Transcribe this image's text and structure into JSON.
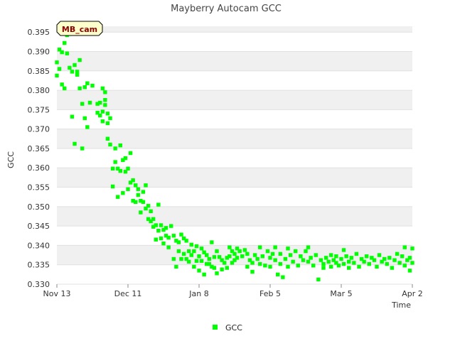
{
  "chart_data": {
    "type": "scatter",
    "title": "Mayberry Autocam GCC",
    "xlabel": "Time",
    "ylabel": "GCC",
    "site_label": "MB_cam",
    "x_ticks": [
      "Nov 13",
      "Dec 11",
      "Jan 8",
      "Feb 5",
      "Mar 5",
      "Apr 2"
    ],
    "xlim": [
      "Nov 13",
      "Apr 2"
    ],
    "y_ticks": [
      0.33,
      0.335,
      0.34,
      0.345,
      0.35,
      0.355,
      0.36,
      0.365,
      0.37,
      0.375,
      0.38,
      0.385,
      0.39,
      0.395
    ],
    "ylim": [
      0.33,
      0.3965
    ],
    "grid": "alternating horizontal bands",
    "legend_position": "bottom-center",
    "series": [
      {
        "name": "GCC",
        "color": "#00ff00",
        "marker": "square",
        "points": [
          {
            "x": "Nov 13",
            "y": 0.3872
          },
          {
            "x": "Nov 13",
            "y": 0.3838
          },
          {
            "x": "Nov 14",
            "y": 0.3855
          },
          {
            "x": "Nov 14",
            "y": 0.3905
          },
          {
            "x": "Nov 15",
            "y": 0.3898
          },
          {
            "x": "Nov 15",
            "y": 0.3815
          },
          {
            "x": "Nov 16",
            "y": 0.3922
          },
          {
            "x": "Nov 16",
            "y": 0.3805
          },
          {
            "x": "Nov 17",
            "y": 0.3942
          },
          {
            "x": "Nov 17",
            "y": 0.3895
          },
          {
            "x": "Nov 18",
            "y": 0.3948
          },
          {
            "x": "Nov 18",
            "y": 0.3858
          },
          {
            "x": "Nov 19",
            "y": 0.3848
          },
          {
            "x": "Nov 19",
            "y": 0.3732
          },
          {
            "x": "Nov 20",
            "y": 0.3865
          },
          {
            "x": "Nov 20",
            "y": 0.3662
          },
          {
            "x": "Nov 21",
            "y": 0.384
          },
          {
            "x": "Nov 21",
            "y": 0.3848
          },
          {
            "x": "Nov 22",
            "y": 0.3805
          },
          {
            "x": "Nov 22",
            "y": 0.3878
          },
          {
            "x": "Nov 23",
            "y": 0.3765
          },
          {
            "x": "Nov 23",
            "y": 0.365
          },
          {
            "x": "Nov 24",
            "y": 0.3808
          },
          {
            "x": "Nov 24",
            "y": 0.3728
          },
          {
            "x": "Nov 25",
            "y": 0.3818
          },
          {
            "x": "Nov 25",
            "y": 0.3705
          },
          {
            "x": "Nov 26",
            "y": 0.3768
          },
          {
            "x": "Nov 27",
            "y": 0.3812
          },
          {
            "x": "Nov 29",
            "y": 0.3742
          },
          {
            "x": "Nov 29",
            "y": 0.3765
          },
          {
            "x": "Nov 30",
            "y": 0.3735
          },
          {
            "x": "Nov 30",
            "y": 0.3768
          },
          {
            "x": "Dec 1",
            "y": 0.3745
          },
          {
            "x": "Dec 1",
            "y": 0.372
          },
          {
            "x": "Dec 1",
            "y": 0.3805
          },
          {
            "x": "Dec 2",
            "y": 0.3775
          },
          {
            "x": "Dec 2",
            "y": 0.3795
          },
          {
            "x": "Dec 2",
            "y": 0.3762
          },
          {
            "x": "Dec 3",
            "y": 0.374
          },
          {
            "x": "Dec 3",
            "y": 0.3715
          },
          {
            "x": "Dec 3",
            "y": 0.3675
          },
          {
            "x": "Dec 4",
            "y": 0.3728
          },
          {
            "x": "Dec 4",
            "y": 0.366
          },
          {
            "x": "Dec 5",
            "y": 0.3598
          },
          {
            "x": "Dec 5",
            "y": 0.3552
          },
          {
            "x": "Dec 6",
            "y": 0.365
          },
          {
            "x": "Dec 6",
            "y": 0.3615
          },
          {
            "x": "Dec 7",
            "y": 0.3598
          },
          {
            "x": "Dec 7",
            "y": 0.3525
          },
          {
            "x": "Dec 8",
            "y": 0.3658
          },
          {
            "x": "Dec 8",
            "y": 0.3592
          },
          {
            "x": "Dec 9",
            "y": 0.362
          },
          {
            "x": "Dec 9",
            "y": 0.3535
          },
          {
            "x": "Dec 10",
            "y": 0.3625
          },
          {
            "x": "Dec 10",
            "y": 0.359
          },
          {
            "x": "Dec 11",
            "y": 0.3598
          },
          {
            "x": "Dec 11",
            "y": 0.3545
          },
          {
            "x": "Dec 12",
            "y": 0.3638
          },
          {
            "x": "Dec 12",
            "y": 0.3562
          },
          {
            "x": "Dec 13",
            "y": 0.3515
          },
          {
            "x": "Dec 13",
            "y": 0.3568
          },
          {
            "x": "Dec 14",
            "y": 0.3555
          },
          {
            "x": "Dec 14",
            "y": 0.3512
          },
          {
            "x": "Dec 15",
            "y": 0.3545
          },
          {
            "x": "Dec 15",
            "y": 0.353
          },
          {
            "x": "Dec 16",
            "y": 0.3515
          },
          {
            "x": "Dec 16",
            "y": 0.3485
          },
          {
            "x": "Dec 17",
            "y": 0.3512
          },
          {
            "x": "Dec 17",
            "y": 0.3538
          },
          {
            "x": "Dec 18",
            "y": 0.3495
          },
          {
            "x": "Dec 18",
            "y": 0.3555
          },
          {
            "x": "Dec 19",
            "y": 0.3502
          },
          {
            "x": "Dec 19",
            "y": 0.3468
          },
          {
            "x": "Dec 20",
            "y": 0.3488
          },
          {
            "x": "Dec 20",
            "y": 0.3462
          },
          {
            "x": "Dec 21",
            "y": 0.3448
          },
          {
            "x": "Dec 21",
            "y": 0.3468
          },
          {
            "x": "Dec 22",
            "y": 0.3452
          },
          {
            "x": "Dec 22",
            "y": 0.3415
          },
          {
            "x": "Dec 23",
            "y": 0.3505
          },
          {
            "x": "Dec 23",
            "y": 0.3438
          },
          {
            "x": "Dec 24",
            "y": 0.3418
          },
          {
            "x": "Dec 24",
            "y": 0.3452
          },
          {
            "x": "Dec 25",
            "y": 0.3405
          },
          {
            "x": "Dec 25",
            "y": 0.344
          },
          {
            "x": "Dec 26",
            "y": 0.3425
          },
          {
            "x": "Dec 26",
            "y": 0.3445
          },
          {
            "x": "Dec 27",
            "y": 0.3395
          },
          {
            "x": "Dec 27",
            "y": 0.342
          },
          {
            "x": "Dec 28",
            "y": 0.345
          },
          {
            "x": "Dec 29",
            "y": 0.3425
          },
          {
            "x": "Dec 29",
            "y": 0.3365
          },
          {
            "x": "Dec 30",
            "y": 0.3412
          },
          {
            "x": "Dec 30",
            "y": 0.3345
          },
          {
            "x": "Dec 31",
            "y": 0.3408
          },
          {
            "x": "Dec 31",
            "y": 0.3385
          },
          {
            "x": "Jan 1",
            "y": 0.3428
          },
          {
            "x": "Jan 1",
            "y": 0.3365
          },
          {
            "x": "Jan 2",
            "y": 0.3418
          },
          {
            "x": "Jan 2",
            "y": 0.3378
          },
          {
            "x": "Jan 3",
            "y": 0.3412
          },
          {
            "x": "Jan 3",
            "y": 0.3365
          },
          {
            "x": "Jan 4",
            "y": 0.3385
          },
          {
            "x": "Jan 4",
            "y": 0.3358
          },
          {
            "x": "Jan 5",
            "y": 0.3402
          },
          {
            "x": "Jan 5",
            "y": 0.3375
          },
          {
            "x": "Jan 6",
            "y": 0.3385
          },
          {
            "x": "Jan 6",
            "y": 0.3345
          },
          {
            "x": "Jan 7",
            "y": 0.3398
          },
          {
            "x": "Jan 7",
            "y": 0.336
          },
          {
            "x": "Jan 8",
            "y": 0.3372
          },
          {
            "x": "Jan 8",
            "y": 0.3335
          },
          {
            "x": "Jan 9",
            "y": 0.3392
          },
          {
            "x": "Jan 9",
            "y": 0.336
          },
          {
            "x": "Jan 10",
            "y": 0.3382
          },
          {
            "x": "Jan 10",
            "y": 0.3325
          },
          {
            "x": "Jan 11",
            "y": 0.3375
          },
          {
            "x": "Jan 11",
            "y": 0.3352
          },
          {
            "x": "Jan 12",
            "y": 0.3365
          },
          {
            "x": "Jan 12",
            "y": 0.3352
          },
          {
            "x": "Jan 13",
            "y": 0.3408
          },
          {
            "x": "Jan 13",
            "y": 0.3345
          },
          {
            "x": "Jan 14",
            "y": 0.337
          },
          {
            "x": "Jan 14",
            "y": 0.3342
          },
          {
            "x": "Jan 15",
            "y": 0.3385
          },
          {
            "x": "Jan 15",
            "y": 0.3328
          },
          {
            "x": "Jan 16",
            "y": 0.337
          },
          {
            "x": "Jan 17",
            "y": 0.3362
          },
          {
            "x": "Jan 17",
            "y": 0.3338
          },
          {
            "x": "Jan 18",
            "y": 0.3355
          },
          {
            "x": "Jan 19",
            "y": 0.3368
          },
          {
            "x": "Jan 19",
            "y": 0.3342
          },
          {
            "x": "Jan 20",
            "y": 0.3395
          },
          {
            "x": "Jan 20",
            "y": 0.3372
          },
          {
            "x": "Jan 21",
            "y": 0.3385
          },
          {
            "x": "Jan 21",
            "y": 0.3355
          },
          {
            "x": "Jan 22",
            "y": 0.3378
          },
          {
            "x": "Jan 22",
            "y": 0.3362
          },
          {
            "x": "Jan 23",
            "y": 0.3392
          },
          {
            "x": "Jan 23",
            "y": 0.3368
          },
          {
            "x": "Jan 24",
            "y": 0.3385
          },
          {
            "x": "Jan 25",
            "y": 0.3372
          },
          {
            "x": "Jan 26",
            "y": 0.3388
          },
          {
            "x": "Jan 27",
            "y": 0.3345
          },
          {
            "x": "Jan 27",
            "y": 0.3378
          },
          {
            "x": "Jan 28",
            "y": 0.3362
          },
          {
            "x": "Jan 29",
            "y": 0.3355
          },
          {
            "x": "Jan 29",
            "y": 0.3332
          },
          {
            "x": "Jan 30",
            "y": 0.3375
          },
          {
            "x": "Jan 31",
            "y": 0.3365
          },
          {
            "x": "Feb 1",
            "y": 0.3395
          },
          {
            "x": "Feb 1",
            "y": 0.3352
          },
          {
            "x": "Feb 2",
            "y": 0.3372
          },
          {
            "x": "Feb 3",
            "y": 0.3348
          },
          {
            "x": "Feb 4",
            "y": 0.3385
          },
          {
            "x": "Feb 5",
            "y": 0.3368
          },
          {
            "x": "Feb 5",
            "y": 0.3345
          },
          {
            "x": "Feb 6",
            "y": 0.3378
          },
          {
            "x": "Feb 7",
            "y": 0.3395
          },
          {
            "x": "Feb 7",
            "y": 0.3362
          },
          {
            "x": "Feb 8",
            "y": 0.3325
          },
          {
            "x": "Feb 9",
            "y": 0.3352
          },
          {
            "x": "Feb 9",
            "y": 0.3378
          },
          {
            "x": "Feb 10",
            "y": 0.3318
          },
          {
            "x": "Feb 11",
            "y": 0.3365
          },
          {
            "x": "Feb 12",
            "y": 0.3392
          },
          {
            "x": "Feb 12",
            "y": 0.3345
          },
          {
            "x": "Feb 13",
            "y": 0.3375
          },
          {
            "x": "Feb 14",
            "y": 0.3358
          },
          {
            "x": "Feb 15",
            "y": 0.3385
          },
          {
            "x": "Feb 16",
            "y": 0.3348
          },
          {
            "x": "Feb 17",
            "y": 0.3372
          },
          {
            "x": "Feb 18",
            "y": 0.3362
          },
          {
            "x": "Feb 19",
            "y": 0.3385
          },
          {
            "x": "Feb 20",
            "y": 0.3395
          },
          {
            "x": "Feb 20",
            "y": 0.3358
          },
          {
            "x": "Feb 21",
            "y": 0.3368
          },
          {
            "x": "Feb 22",
            "y": 0.3348
          },
          {
            "x": "Feb 23",
            "y": 0.3375
          },
          {
            "x": "Feb 24",
            "y": 0.3312
          },
          {
            "x": "Feb 25",
            "y": 0.3362
          },
          {
            "x": "Feb 26",
            "y": 0.3352
          },
          {
            "x": "Feb 26",
            "y": 0.3342
          },
          {
            "x": "Feb 27",
            "y": 0.3368
          },
          {
            "x": "Feb 28",
            "y": 0.3358
          },
          {
            "x": "Mar 1",
            "y": 0.3375
          },
          {
            "x": "Mar 1",
            "y": 0.3345
          },
          {
            "x": "Mar 2",
            "y": 0.3362
          },
          {
            "x": "Mar 3",
            "y": 0.3355
          },
          {
            "x": "Mar 3",
            "y": 0.3372
          },
          {
            "x": "Mar 4",
            "y": 0.3348
          },
          {
            "x": "Mar 5",
            "y": 0.3365
          },
          {
            "x": "Mar 6",
            "y": 0.3388
          },
          {
            "x": "Mar 6",
            "y": 0.3352
          },
          {
            "x": "Mar 7",
            "y": 0.3372
          },
          {
            "x": "Mar 8",
            "y": 0.3358
          },
          {
            "x": "Mar 8",
            "y": 0.3342
          },
          {
            "x": "Mar 9",
            "y": 0.3368
          },
          {
            "x": "Mar 10",
            "y": 0.3355
          },
          {
            "x": "Mar 11",
            "y": 0.3378
          },
          {
            "x": "Mar 12",
            "y": 0.3345
          },
          {
            "x": "Mar 13",
            "y": 0.3365
          },
          {
            "x": "Mar 14",
            "y": 0.3358
          },
          {
            "x": "Mar 15",
            "y": 0.3372
          },
          {
            "x": "Mar 16",
            "y": 0.3352
          },
          {
            "x": "Mar 17",
            "y": 0.3368
          },
          {
            "x": "Mar 18",
            "y": 0.3362
          },
          {
            "x": "Mar 19",
            "y": 0.3345
          },
          {
            "x": "Mar 20",
            "y": 0.3375
          },
          {
            "x": "Mar 21",
            "y": 0.3358
          },
          {
            "x": "Mar 22",
            "y": 0.3365
          },
          {
            "x": "Mar 23",
            "y": 0.3352
          },
          {
            "x": "Mar 24",
            "y": 0.3368
          },
          {
            "x": "Mar 25",
            "y": 0.3342
          },
          {
            "x": "Mar 26",
            "y": 0.3362
          },
          {
            "x": "Mar 27",
            "y": 0.3378
          },
          {
            "x": "Mar 28",
            "y": 0.3355
          },
          {
            "x": "Mar 29",
            "y": 0.3372
          },
          {
            "x": "Mar 30",
            "y": 0.3395
          },
          {
            "x": "Mar 30",
            "y": 0.3348
          },
          {
            "x": "Mar 31",
            "y": 0.3362
          },
          {
            "x": "Apr 1",
            "y": 0.3335
          },
          {
            "x": "Apr 1",
            "y": 0.3368
          },
          {
            "x": "Apr 2",
            "y": 0.3392
          },
          {
            "x": "Apr 2",
            "y": 0.3355
          }
        ]
      }
    ]
  }
}
